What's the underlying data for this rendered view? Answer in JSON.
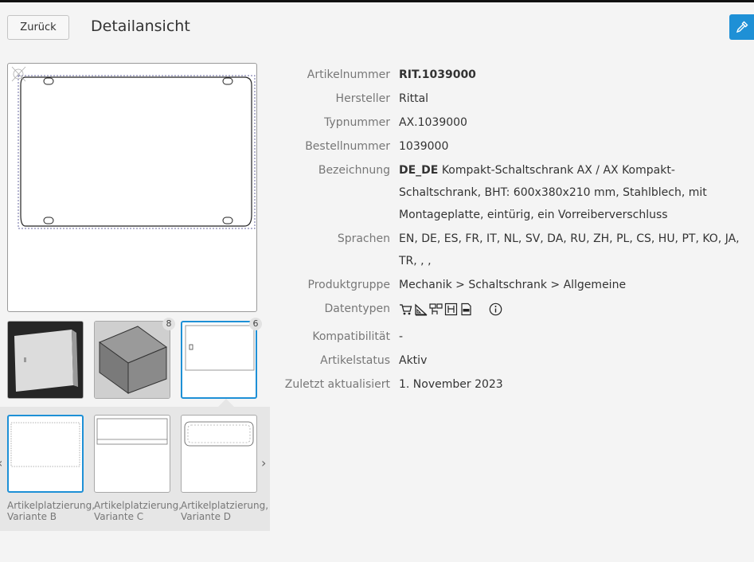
{
  "header": {
    "back_label": "Zurück",
    "title": "Detailansicht",
    "tool_icon": "eyedropper-icon"
  },
  "gallery": {
    "thumbnails": [
      {
        "name": "product-photo",
        "badge": ""
      },
      {
        "name": "3d-model",
        "badge": "8"
      },
      {
        "name": "drawing",
        "badge": "6"
      }
    ],
    "variants": [
      {
        "label": "Artikelplatzierung, Variante B"
      },
      {
        "label": "Artikelplatzierung, Variante C"
      },
      {
        "label": "Artikelplatzierung, Variante D"
      }
    ]
  },
  "details": {
    "artikelnummer": {
      "label": "Artikelnummer",
      "value": "RIT.1039000"
    },
    "hersteller": {
      "label": "Hersteller",
      "value": "Rittal"
    },
    "typnummer": {
      "label": "Typnummer",
      "value": "AX.1039000"
    },
    "bestellnummer": {
      "label": "Bestellnummer",
      "value": "1039000"
    },
    "bezeichnung": {
      "label": "Bezeichnung",
      "lang": "DE_DE",
      "value": "Kompakt-Schaltschrank AX / AX Kompakt-Schaltschrank, BHT: 600x380x210 mm, Stahlblech, mit Montageplatte, eintürig, ein Vorreiberverschluss"
    },
    "sprachen": {
      "label": "Sprachen",
      "value": "EN, DE, ES, FR, IT, NL, SV, DA, RU, ZH, PL, CS, HU, PT, KO, JA, TR, , ,"
    },
    "produktgruppe": {
      "label": "Produktgruppe",
      "value": "Mechanik > Schaltschrank > Allgemeine"
    },
    "datentypen": {
      "label": "Datentypen",
      "icons": [
        "cart-icon",
        "measure-icon",
        "schematic-icon",
        "macro-icon",
        "pdf-icon",
        "info-icon"
      ]
    },
    "kompatibilitaet": {
      "label": "Kompatibilität",
      "value": "-"
    },
    "artikelstatus": {
      "label": "Artikelstatus",
      "value": "Aktiv"
    },
    "aktualisiert": {
      "label": "Zuletzt aktualisiert",
      "value": "1. November 2023"
    }
  },
  "colors": {
    "accent": "#1e90d6",
    "background": "#f4f4f4",
    "panel": "#e6e6e6"
  }
}
